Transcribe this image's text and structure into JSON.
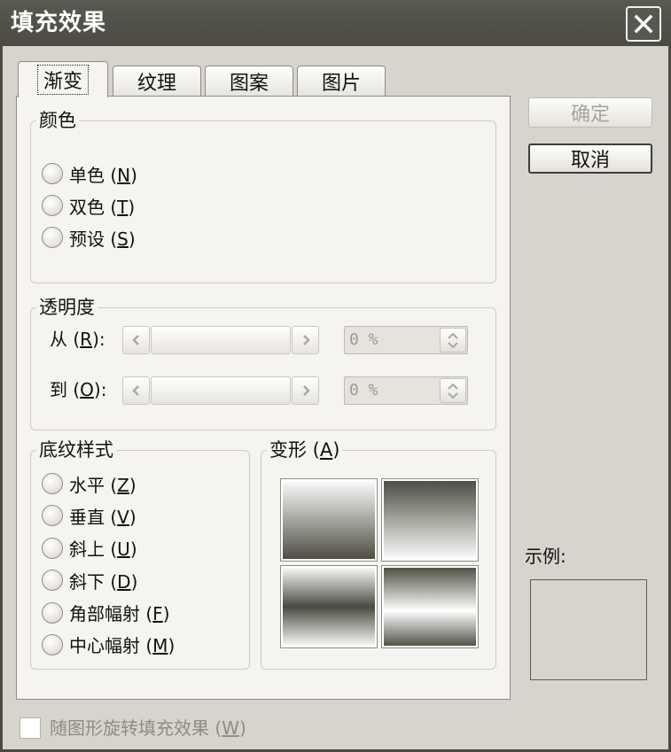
{
  "window": {
    "title": "填充效果",
    "close_icon": "close-icon"
  },
  "tabs": [
    {
      "label": "渐变",
      "selected": true
    },
    {
      "label": "纹理",
      "selected": false
    },
    {
      "label": "图案",
      "selected": false
    },
    {
      "label": "图片",
      "selected": false
    }
  ],
  "colors_group": {
    "title": "颜色",
    "options": [
      {
        "label": "单色 (N)",
        "selected": false
      },
      {
        "label": "双色 (T)",
        "selected": false
      },
      {
        "label": "预设 (S)",
        "selected": false
      }
    ]
  },
  "transparency_group": {
    "title": "透明度",
    "from": {
      "label": "从 (R):",
      "value": "0 %",
      "enabled": false
    },
    "to": {
      "label": "到 (O):",
      "value": "0 %",
      "enabled": false
    },
    "icons": {
      "left": "chevron-left-icon",
      "right": "chevron-right-icon",
      "up": "chevron-up-icon",
      "down": "chevron-down-icon"
    }
  },
  "shading_group": {
    "title": "底纹样式",
    "options": [
      {
        "label": "水平 (Z)",
        "selected": false
      },
      {
        "label": "垂直 (V)",
        "selected": false
      },
      {
        "label": "斜上 (U)",
        "selected": false
      },
      {
        "label": "斜下 (D)",
        "selected": false
      },
      {
        "label": "角部幅射 (F)",
        "selected": false
      },
      {
        "label": "中心幅射 (M)",
        "selected": false
      }
    ]
  },
  "variants_group": {
    "title": "变形 (A)"
  },
  "buttons": {
    "ok": {
      "label": "确定",
      "enabled": false
    },
    "cancel": {
      "label": "取消",
      "enabled": true
    }
  },
  "sample": {
    "label": "示例:"
  },
  "rotate_checkbox": {
    "label": "随图形旋转填充效果 (W)",
    "checked": false,
    "enabled": false
  },
  "colors": {
    "gradient_dark": "#4b4a3e",
    "gradient_light": "#ffffff",
    "titlebar": "#4b4a43"
  }
}
